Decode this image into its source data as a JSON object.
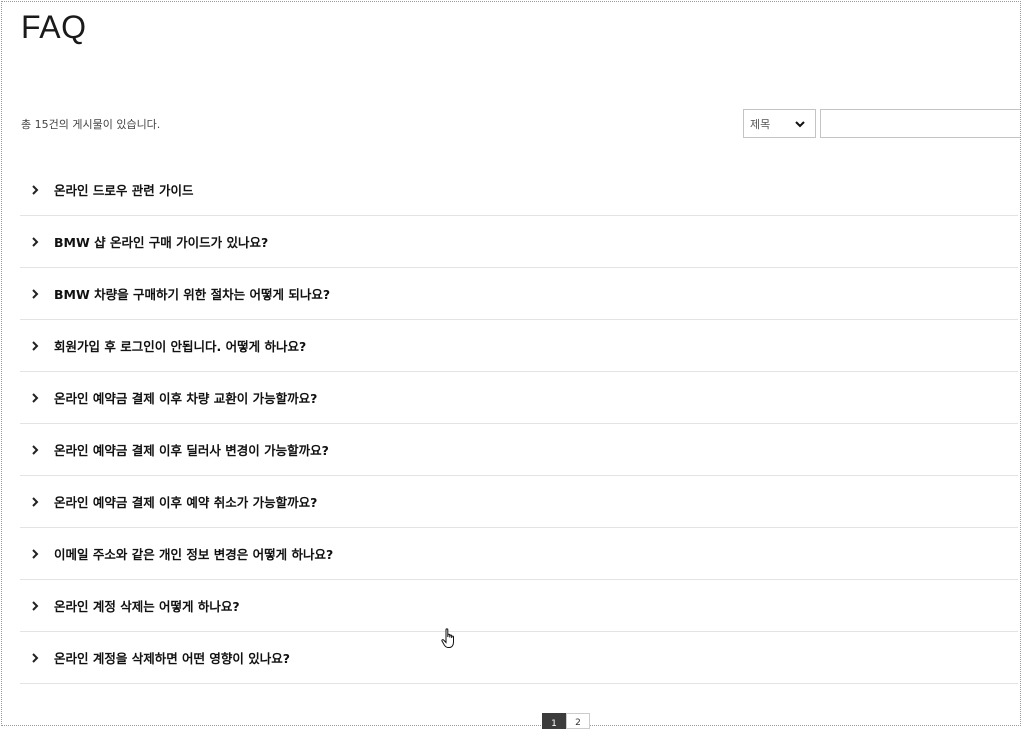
{
  "page_title": "FAQ",
  "total_count_text": "총 15건의 게시물이 있습니다.",
  "search": {
    "field_label": "제목",
    "field_icon": "chevron-down-icon",
    "keyword_value": ""
  },
  "faq_items": [
    {
      "question": "온라인 드로우 관련 가이드"
    },
    {
      "question": "BMW 샵 온라인 구매 가이드가 있나요?"
    },
    {
      "question": "BMW 차량을 구매하기 위한 절차는 어떻게 되나요?"
    },
    {
      "question": "회원가입 후 로그인이 안됩니다. 어떻게 하나요?"
    },
    {
      "question": "온라인 예약금 결제 이후 차량 교환이 가능할까요?"
    },
    {
      "question": "온라인 예약금 결제 이후 딜러사 변경이 가능할까요?"
    },
    {
      "question": "온라인 예약금 결제 이후 예약 취소가 가능할까요?"
    },
    {
      "question": "이메일 주소와 같은 개인 정보 변경은 어떻게 하나요?"
    },
    {
      "question": "온라인 계정 삭제는 어떻게 하나요?"
    },
    {
      "question": "온라인 계정을 삭제하면 어떤 영향이 있나요?"
    }
  ],
  "pagination": {
    "pages": [
      "1",
      "2"
    ],
    "current": "1",
    "active_color": "#3c3c3c"
  }
}
